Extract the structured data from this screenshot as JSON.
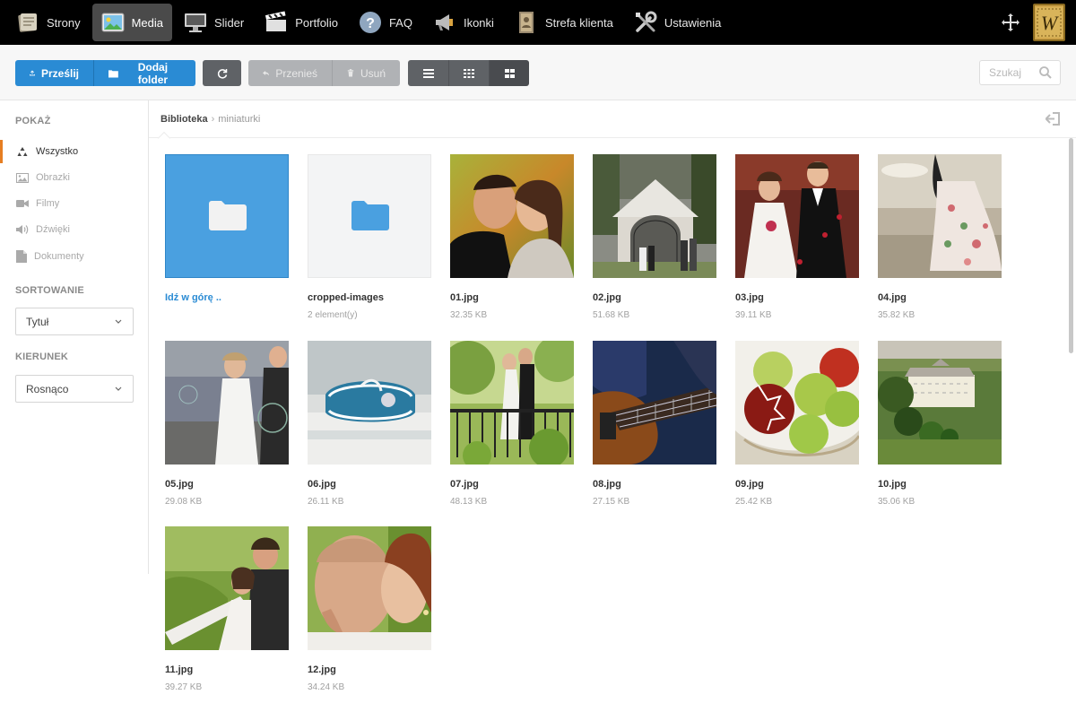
{
  "nav": {
    "items": [
      {
        "label": "Strony",
        "icon": "pages-icon",
        "active": false
      },
      {
        "label": "Media",
        "icon": "media-icon",
        "active": true
      },
      {
        "label": "Slider",
        "icon": "slider-icon",
        "active": false
      },
      {
        "label": "Portfolio",
        "icon": "portfolio-icon",
        "active": false
      },
      {
        "label": "FAQ",
        "icon": "faq-icon",
        "active": false
      },
      {
        "label": "Ikonki",
        "icon": "megaphone-icon",
        "active": false
      },
      {
        "label": "Strefa klienta",
        "icon": "client-zone-icon",
        "active": false
      },
      {
        "label": "Ustawienia",
        "icon": "settings-icon",
        "active": false
      }
    ],
    "logo_letter": "W"
  },
  "toolbar": {
    "upload_label": "Prześlij",
    "add_folder_label": "Dodaj folder",
    "move_label": "Przenieś",
    "delete_label": "Usuń",
    "search_placeholder": "Szukaj"
  },
  "sidebar": {
    "show_heading": "POKAŻ",
    "filters": [
      "Wszystko",
      "Obrazki",
      "Filmy",
      "Dźwięki",
      "Dokumenty"
    ],
    "sort_heading": "SORTOWANIE",
    "sort_value": "Tytuł",
    "direction_heading": "KIERUNEK",
    "direction_value": "Rosnąco"
  },
  "breadcrumb": {
    "root": "Biblioteka",
    "separator": "›",
    "current": "miniaturki"
  },
  "files": [
    {
      "name": "Idź w górę ..",
      "meta": "",
      "kind": "folder-up"
    },
    {
      "name": "cropped-images",
      "meta": "2 element(y)",
      "kind": "folder"
    },
    {
      "name": "01.jpg",
      "meta": "32.35 KB",
      "kind": "image"
    },
    {
      "name": "02.jpg",
      "meta": "51.68 KB",
      "kind": "image"
    },
    {
      "name": "03.jpg",
      "meta": "39.11 KB",
      "kind": "image"
    },
    {
      "name": "04.jpg",
      "meta": "35.82 KB",
      "kind": "image"
    },
    {
      "name": "05.jpg",
      "meta": "29.08 KB",
      "kind": "image"
    },
    {
      "name": "06.jpg",
      "meta": "26.11 KB",
      "kind": "image"
    },
    {
      "name": "07.jpg",
      "meta": "48.13 KB",
      "kind": "image"
    },
    {
      "name": "08.jpg",
      "meta": "27.15 KB",
      "kind": "image"
    },
    {
      "name": "09.jpg",
      "meta": "25.42 KB",
      "kind": "image"
    },
    {
      "name": "10.jpg",
      "meta": "35.06 KB",
      "kind": "image"
    },
    {
      "name": "11.jpg",
      "meta": "39.27 KB",
      "kind": "image"
    },
    {
      "name": "12.jpg",
      "meta": "34.24 KB",
      "kind": "image"
    }
  ],
  "colors": {
    "accent_blue": "#2a8bd4",
    "active_filter": "#e67e22",
    "nav_bg": "#000000"
  }
}
